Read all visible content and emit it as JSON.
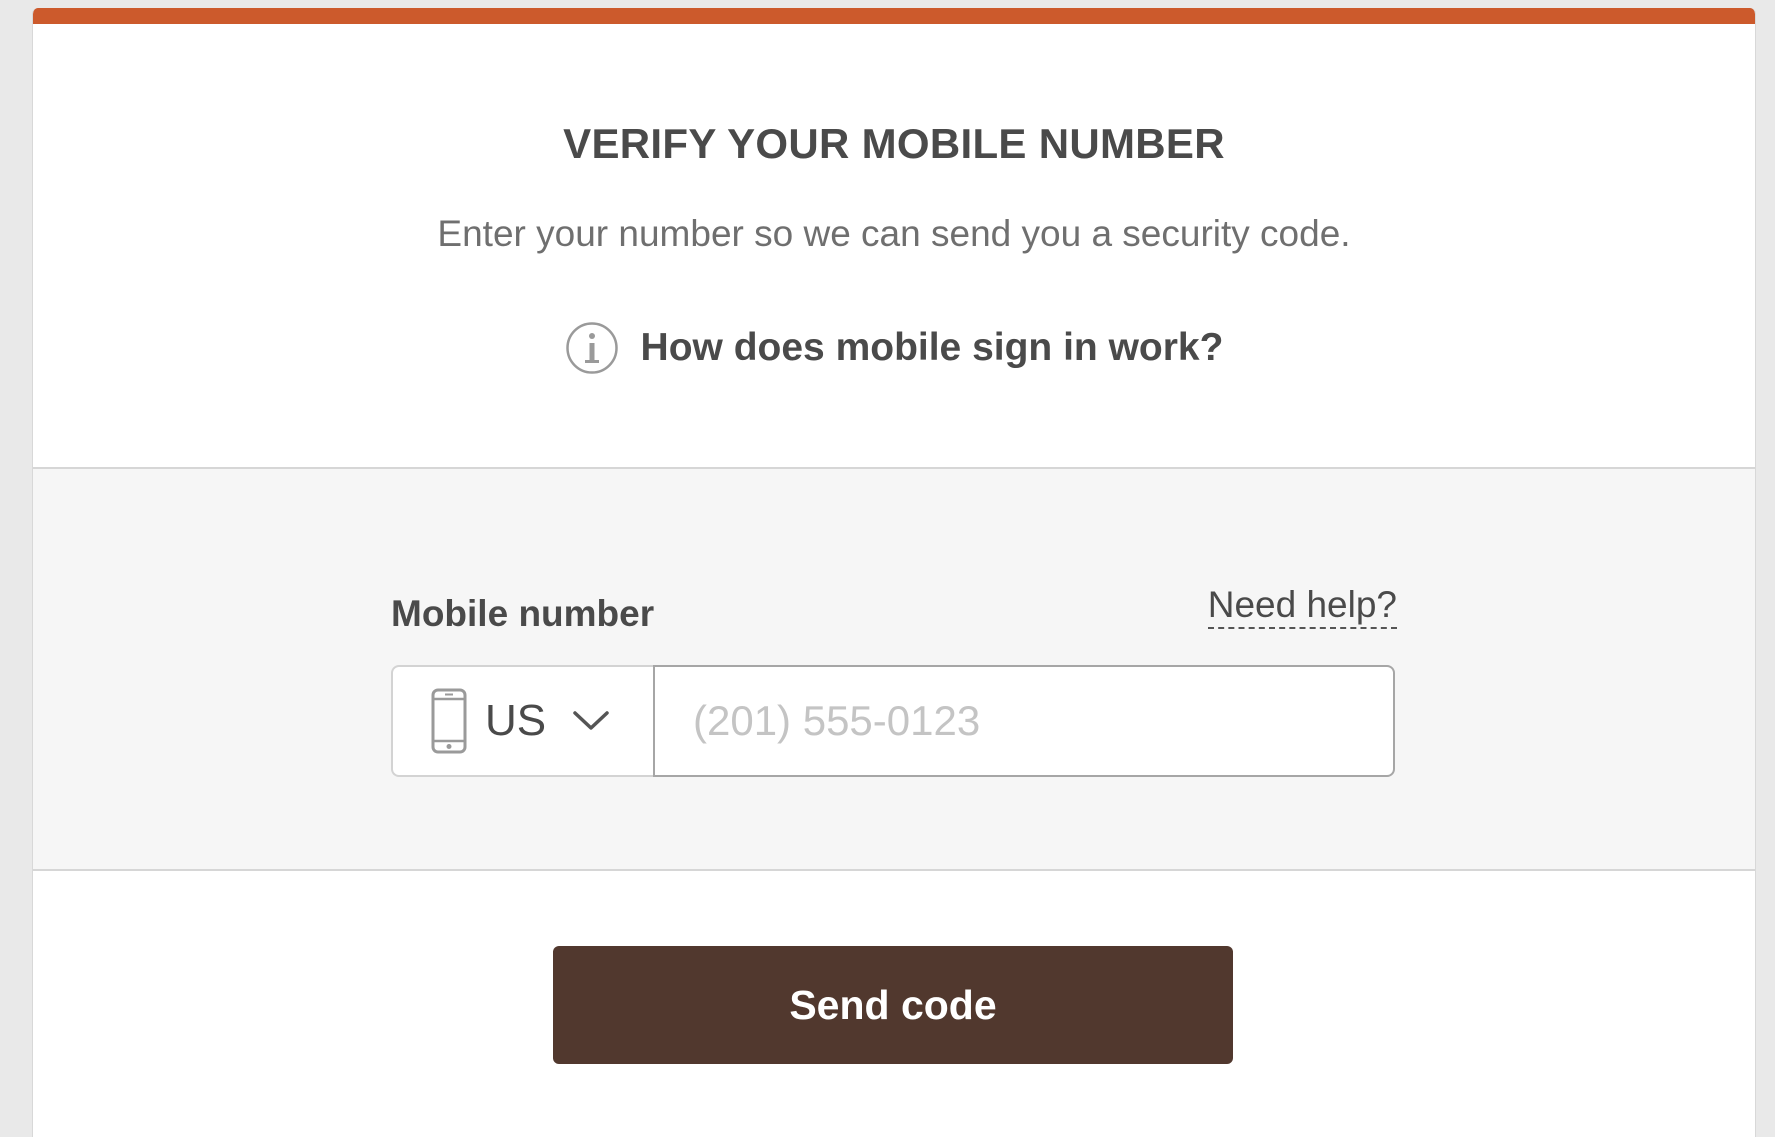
{
  "header": {
    "title": "VERIFY YOUR MOBILE NUMBER",
    "subtitle": "Enter your number so we can send you a security code.",
    "info_link": "How does mobile sign in work?"
  },
  "form": {
    "label": "Mobile number",
    "help_link": "Need help?",
    "country": {
      "selected": "US",
      "icon": "mobile-phone-icon"
    },
    "phone_input": {
      "value": "",
      "placeholder": "(201) 555-0123"
    }
  },
  "actions": {
    "send_label": "Send code"
  },
  "colors": {
    "accent": "#cc5a2c",
    "button": "#51382e",
    "text": "#4a4a4a",
    "muted_text": "#6f6f6f",
    "section_bg": "#f6f6f6"
  }
}
